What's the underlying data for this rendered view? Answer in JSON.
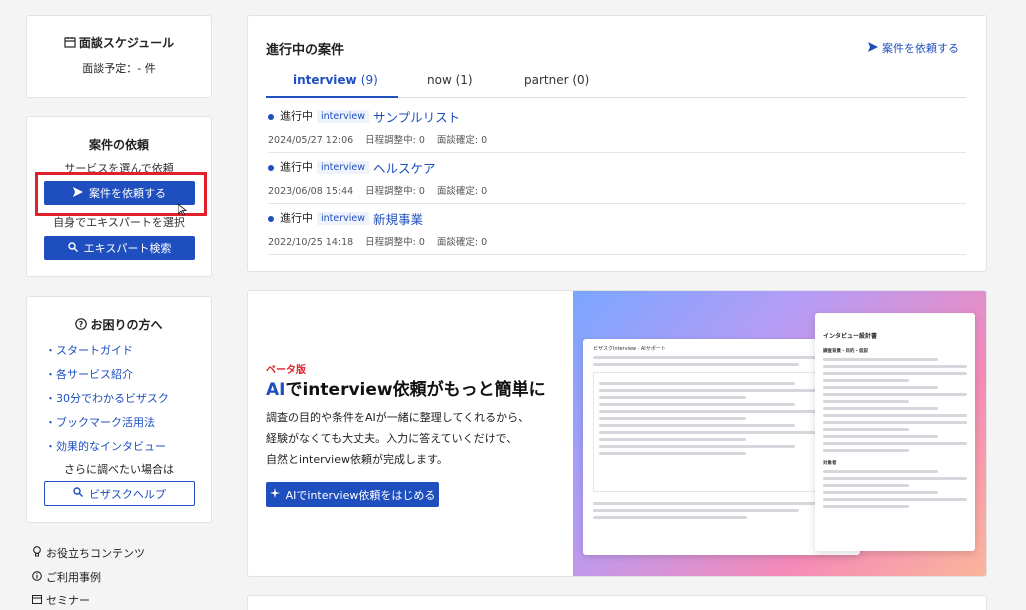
{
  "schedule_card": {
    "title": "面談スケジュール",
    "planned": "面談予定：- 件"
  },
  "request_card": {
    "title": "案件の依頼",
    "sub1": "サービスを選んで依頼",
    "request_button": "案件を依頼する",
    "sub2": "自身でエキスパートを選択",
    "expert_search_button": "エキスパート検索"
  },
  "help_card": {
    "title": "お困りの方へ",
    "links": [
      "・スタートガイド",
      "・各サービス紹介",
      "・30分でわかるビザスク",
      "・ブックマーク活用法",
      "・効果的なインタビュー"
    ],
    "more_text": "さらに調べたい場合は",
    "help_button": "ビザスクヘルプ"
  },
  "footer_links": [
    "お役立ちコンテンツ",
    "ご利用事例",
    "セミナー"
  ],
  "cases": {
    "title": "進行中の案件",
    "request_link": "案件を依頼する",
    "tabs": [
      {
        "name": "interview",
        "count": "(9)"
      },
      {
        "name": "now",
        "count": "(1)"
      },
      {
        "name": "partner",
        "count": "(0)"
      }
    ],
    "items": [
      {
        "status": "進行中",
        "tag": "interview",
        "title": "サンプルリスト",
        "date": "2024/05/27 12:06",
        "adjusting": "日程調整中: 0",
        "confirmed": "面談確定: 0"
      },
      {
        "status": "進行中",
        "tag": "interview",
        "title": "ヘルスケア",
        "date": "2023/06/08 15:44",
        "adjusting": "日程調整中: 0",
        "confirmed": "面談確定: 0"
      },
      {
        "status": "進行中",
        "tag": "interview",
        "title": "新規事業",
        "date": "2022/10/25 14:18",
        "adjusting": "日程調整中: 0",
        "confirmed": "面談確定: 0"
      }
    ]
  },
  "promo": {
    "beta": "ベータ版",
    "heading_ai": "AI",
    "heading_rest": "でinterview依頼がもっと簡単に",
    "body1": "調査の目的や条件をAIが一緒に整理してくれるから、",
    "body2": "経験がなくても大丈夫。入力に答えていくだけで、",
    "body3": "自然とinterview依頼が完成します。",
    "cta": "AIでinterview依頼をはじめる",
    "doc_title": "インタビュー設計書",
    "doc_header": "ビザスクinterview · AIサポート",
    "doc_section": "調査背景・目的・仮説",
    "doc_section2": "対象者"
  },
  "colors": {
    "accent": "#1f4fbf",
    "highlight_box": "#e0202a",
    "beta": "#e0202a"
  }
}
